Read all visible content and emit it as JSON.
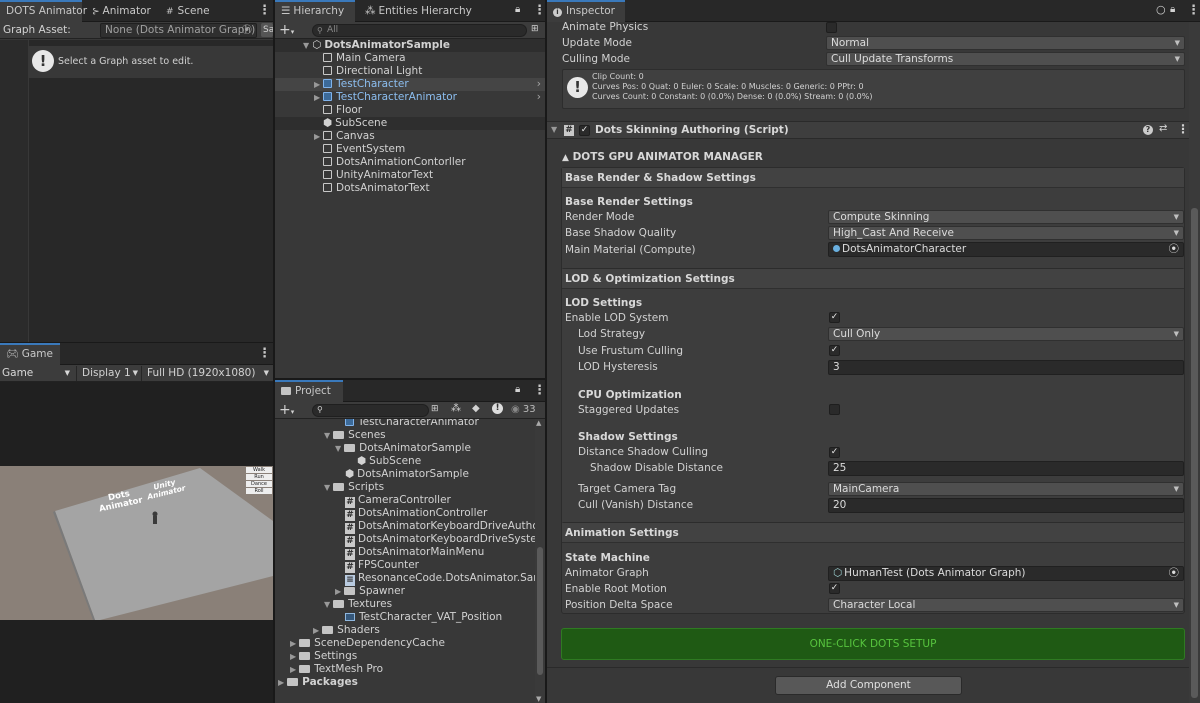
{
  "animator_panel": {
    "tabs": [
      {
        "label": "DOTS Animator"
      },
      {
        "label": "Animator"
      },
      {
        "label": "Scene"
      }
    ],
    "graph_asset_label": "Graph Asset:",
    "graph_asset_value": "None (Dots Animator Graph)",
    "message": "Select a Graph asset to edit."
  },
  "game_panel": {
    "tab": "Game",
    "mode": "Game",
    "display": "Display 1",
    "resolution": "Full HD (1920x1080)",
    "scene_text_1": "Dots\nAnimator",
    "scene_text_2": "Unity\nAnimator",
    "buttons": [
      "Walk",
      "Run",
      "Dance",
      "Roll"
    ]
  },
  "hierarchy": {
    "tabs": [
      {
        "label": "Hierarchy"
      },
      {
        "label": "Entities Hierarchy"
      }
    ],
    "search_placeholder": "All",
    "root": "DotsAnimatorSample",
    "items": [
      {
        "label": "Main Camera",
        "type": "go"
      },
      {
        "label": "Directional Light",
        "type": "go"
      },
      {
        "label": "TestCharacter",
        "type": "prefab"
      },
      {
        "label": "TestCharacterAnimator",
        "type": "prefab"
      },
      {
        "label": "Floor",
        "type": "go"
      },
      {
        "label": "SubScene",
        "type": "subscene"
      },
      {
        "label": "Canvas",
        "type": "go"
      },
      {
        "label": "EventSystem",
        "type": "go"
      },
      {
        "label": "DotsAnimationContorller",
        "type": "go"
      },
      {
        "label": "UnityAnimatorText",
        "type": "go"
      },
      {
        "label": "DotsAnimatorText",
        "type": "go"
      }
    ]
  },
  "project": {
    "tab": "Project",
    "hidden_count": "33",
    "items": [
      {
        "label": "TestCharacterAnimator",
        "type": "prefab",
        "indent": 4
      },
      {
        "label": "Scenes",
        "type": "folder-open",
        "indent": 3
      },
      {
        "label": "DotsAnimatorSample",
        "type": "folder-open",
        "indent": 4
      },
      {
        "label": "SubScene",
        "type": "scene",
        "indent": 5
      },
      {
        "label": "DotsAnimatorSample",
        "type": "scene",
        "indent": 4
      },
      {
        "label": "Scripts",
        "type": "folder-open",
        "indent": 3
      },
      {
        "label": "CameraController",
        "type": "script",
        "indent": 4
      },
      {
        "label": "DotsAnimationController",
        "type": "script",
        "indent": 4
      },
      {
        "label": "DotsAnimatorKeyboardDriveAuthoring",
        "type": "script",
        "indent": 4
      },
      {
        "label": "DotsAnimatorKeyboardDriveSystem",
        "type": "script",
        "indent": 4
      },
      {
        "label": "DotsAnimatorMainMenu",
        "type": "script",
        "indent": 4
      },
      {
        "label": "FPSCounter",
        "type": "script",
        "indent": 4
      },
      {
        "label": "ResonanceCode.DotsAnimator.Sampl",
        "type": "asm",
        "indent": 4
      },
      {
        "label": "Spawner",
        "type": "folder",
        "indent": 4
      },
      {
        "label": "Textures",
        "type": "folder-open",
        "indent": 3
      },
      {
        "label": "TestCharacter_VAT_Position",
        "type": "texture",
        "indent": 4
      },
      {
        "label": "Shaders",
        "type": "folder",
        "indent": 2
      },
      {
        "label": "SceneDependencyCache",
        "type": "folder",
        "indent": 1
      },
      {
        "label": "Settings",
        "type": "folder",
        "indent": 1
      },
      {
        "label": "TextMesh Pro",
        "type": "folder",
        "indent": 1
      },
      {
        "label": "Packages",
        "type": "folder",
        "indent": 0
      }
    ]
  },
  "inspector": {
    "tab": "Inspector",
    "animate_physics": "Animate Physics",
    "update_mode_label": "Update Mode",
    "update_mode_value": "Normal",
    "culling_mode_label": "Culling Mode",
    "culling_mode_value": "Cull Update Transforms",
    "info_lines": [
      "Clip Count: 0",
      "Curves Pos: 0 Quat: 0 Euler: 0 Scale: 0 Muscles: 0 Generic: 0 PPtr: 0",
      "Curves Count: 0 Constant: 0 (0.0%) Dense: 0 (0.0%) Stream: 0 (0.0%)"
    ],
    "component_title": "Dots Skinning Authoring (Script)",
    "manager_title": "DOTS GPU ANIMATOR MANAGER",
    "base_section": "Base Render & Shadow Settings",
    "base_sub": "Base Render Settings",
    "render_mode_label": "Render Mode",
    "render_mode_value": "Compute Skinning",
    "shadow_quality_label": "Base Shadow Quality",
    "shadow_quality_value": "High_Cast And Receive",
    "material_label": "Main Material (Compute)",
    "material_value": "DotsAnimatorCharacter",
    "lod_section": "LOD & Optimization Settings",
    "lod_sub": "LOD Settings",
    "enable_lod_label": "Enable LOD System",
    "lod_strategy_label": "Lod Strategy",
    "lod_strategy_value": "Cull Only",
    "frustum_label": "Use Frustum Culling",
    "hysteresis_label": "LOD Hysteresis",
    "hysteresis_value": "3",
    "cpu_sub": "CPU Optimization",
    "staggered_label": "Staggered Updates",
    "shadow_sub": "Shadow Settings",
    "dist_shadow_label": "Distance Shadow Culling",
    "shadow_disable_label": "Shadow Disable Distance",
    "shadow_disable_value": "25",
    "camera_tag_label": "Target Camera Tag",
    "camera_tag_value": "MainCamera",
    "cull_dist_label": "Cull (Vanish) Distance",
    "cull_dist_value": "20",
    "anim_section": "Animation Settings",
    "state_sub": "State Machine",
    "graph_label": "Animator Graph",
    "graph_value": "HumanTest (Dots Animator Graph)",
    "root_motion_label": "Enable Root Motion",
    "delta_space_label": "Position Delta Space",
    "delta_space_value": "Character Local",
    "setup_button": "ONE-CLICK DOTS SETUP",
    "add_component": "Add Component"
  },
  "colors": {
    "accent": "#3a79bb",
    "setup_bg": "#1f5a14",
    "setup_text": "#57c43e"
  }
}
